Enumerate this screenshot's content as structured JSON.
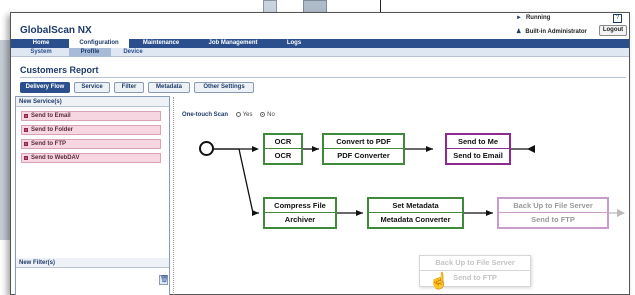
{
  "app": {
    "name": "GlobalScan NX",
    "status": "Running",
    "user": "Built-in Administrator",
    "logout_label": "Logout",
    "help_label": "?"
  },
  "nav": {
    "primary": [
      {
        "label": "Home"
      },
      {
        "label": "Configuration",
        "active": true
      },
      {
        "label": "Maintenance"
      },
      {
        "label": "Job Management"
      },
      {
        "label": "Logs"
      }
    ],
    "secondary": [
      {
        "label": "System"
      },
      {
        "label": "Profile",
        "active": true
      },
      {
        "label": "Device"
      }
    ]
  },
  "page": {
    "title": "Customers Report"
  },
  "subtabs": [
    {
      "label": "Delivery Flow",
      "active": true
    },
    {
      "label": "Service"
    },
    {
      "label": "Filter"
    },
    {
      "label": "Metadata"
    },
    {
      "label": "Other Settings"
    }
  ],
  "left_panel": {
    "services_heading": "New Service(s)",
    "services": [
      "Send to Email",
      "Send to Folder",
      "Send to FTP",
      "Send to WebDAV"
    ],
    "filters_heading": "New Filter(s)"
  },
  "one_touch_scan": {
    "label": "One-touch Scan",
    "options": [
      "Yes",
      "No"
    ],
    "selected": "No"
  },
  "flow": {
    "row1": [
      {
        "top": "OCR",
        "bottom": "OCR",
        "color": "green"
      },
      {
        "top": "Convert to PDF",
        "bottom": "PDF Converter",
        "color": "green"
      },
      {
        "top": "Send to Me",
        "bottom": "Send to Email",
        "color": "purple"
      }
    ],
    "row2": [
      {
        "top": "Compress File",
        "bottom": "Archiver",
        "color": "green"
      },
      {
        "top": "Set Metadata",
        "bottom": "Metadata Converter",
        "color": "green"
      },
      {
        "top": "Back Up to File Server",
        "bottom": "Send to FTP",
        "color": "light-purple"
      }
    ],
    "dragging": {
      "top": "Back Up to File Server",
      "bottom": "Send to FTP"
    }
  },
  "colors": {
    "brand": "#2a4f8c",
    "filter_box": "#3f8a3a",
    "destination_box": "#8c2a8f",
    "service_item": "#f6d6e0"
  }
}
